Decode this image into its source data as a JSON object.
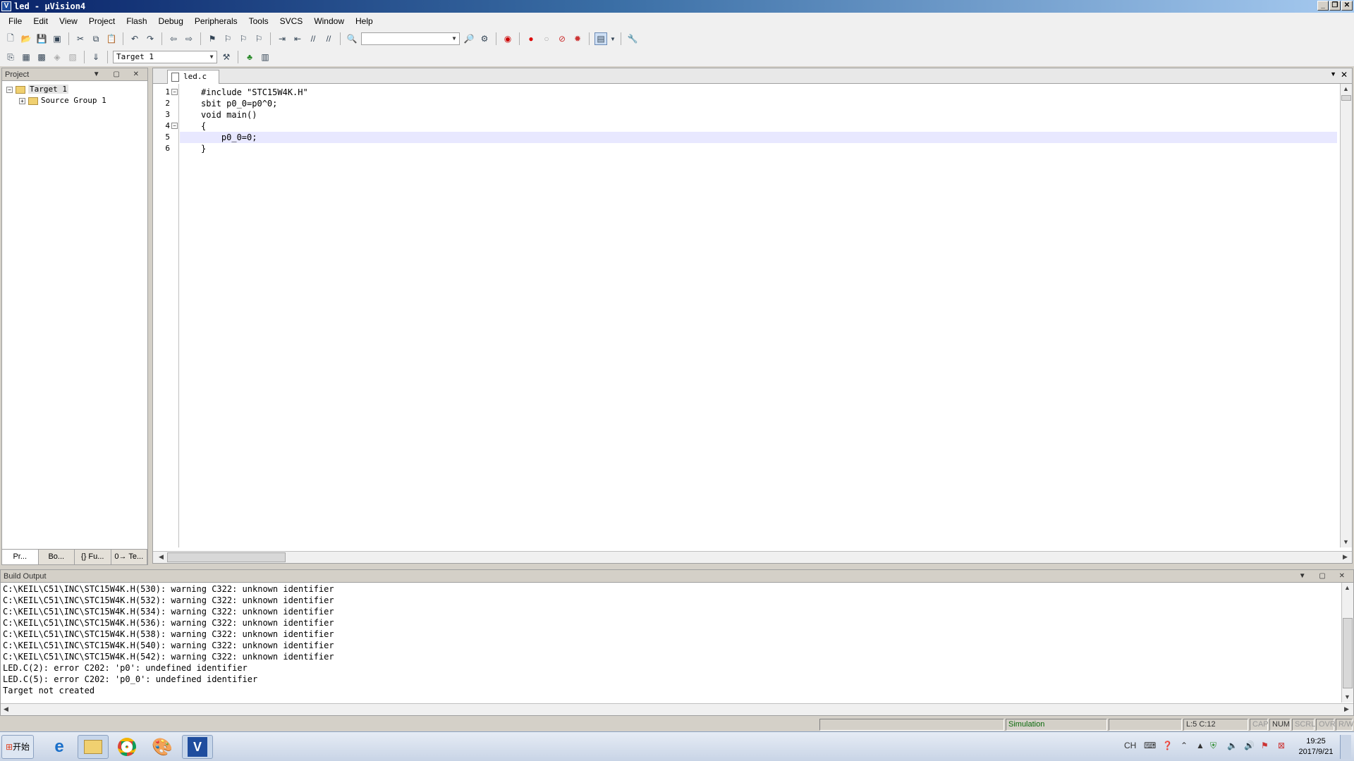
{
  "window": {
    "title": "led - µVision4",
    "app_icon_letter": "V"
  },
  "menu": [
    "File",
    "Edit",
    "View",
    "Project",
    "Flash",
    "Debug",
    "Peripherals",
    "Tools",
    "SVCS",
    "Window",
    "Help"
  ],
  "toolbar2": {
    "target": "Target 1"
  },
  "project": {
    "header": "Project",
    "tree": {
      "target": "Target 1",
      "group": "Source Group 1"
    },
    "tabs": [
      "Pr...",
      "Bo...",
      "{} Fu...",
      "0→ Te..."
    ]
  },
  "editor": {
    "tab": "led.c",
    "lines": [
      {
        "n": "1",
        "text": "#include \"STC15W4K.H\""
      },
      {
        "n": "2",
        "text": "sbit p0_0=p0^0;"
      },
      {
        "n": "3",
        "text": "void main()"
      },
      {
        "n": "4",
        "text": "{"
      },
      {
        "n": "5",
        "text": "    p0_0=0;"
      },
      {
        "n": "6",
        "text": "}"
      }
    ]
  },
  "build": {
    "header": "Build Output",
    "lines": [
      "C:\\KEIL\\C51\\INC\\STC15W4K.H(530): warning C322: unknown identifier",
      "C:\\KEIL\\C51\\INC\\STC15W4K.H(532): warning C322: unknown identifier",
      "C:\\KEIL\\C51\\INC\\STC15W4K.H(534): warning C322: unknown identifier",
      "C:\\KEIL\\C51\\INC\\STC15W4K.H(536): warning C322: unknown identifier",
      "C:\\KEIL\\C51\\INC\\STC15W4K.H(538): warning C322: unknown identifier",
      "C:\\KEIL\\C51\\INC\\STC15W4K.H(540): warning C322: unknown identifier",
      "C:\\KEIL\\C51\\INC\\STC15W4K.H(542): warning C322: unknown identifier",
      "LED.C(2): error C202: 'p0': undefined identifier",
      "LED.C(5): error C202: 'p0_0': undefined identifier",
      "Target not created"
    ]
  },
  "status": {
    "mode": "Simulation",
    "position": "L:5 C:12",
    "cap": "CAP",
    "num": "NUM",
    "scrl": "SCRL",
    "ovr": "OVR",
    "rw": "R/W"
  },
  "taskbar": {
    "start": "开始",
    "lang": "CH",
    "time": "19:25",
    "date": "2017/9/21",
    "app_letter": "V"
  }
}
